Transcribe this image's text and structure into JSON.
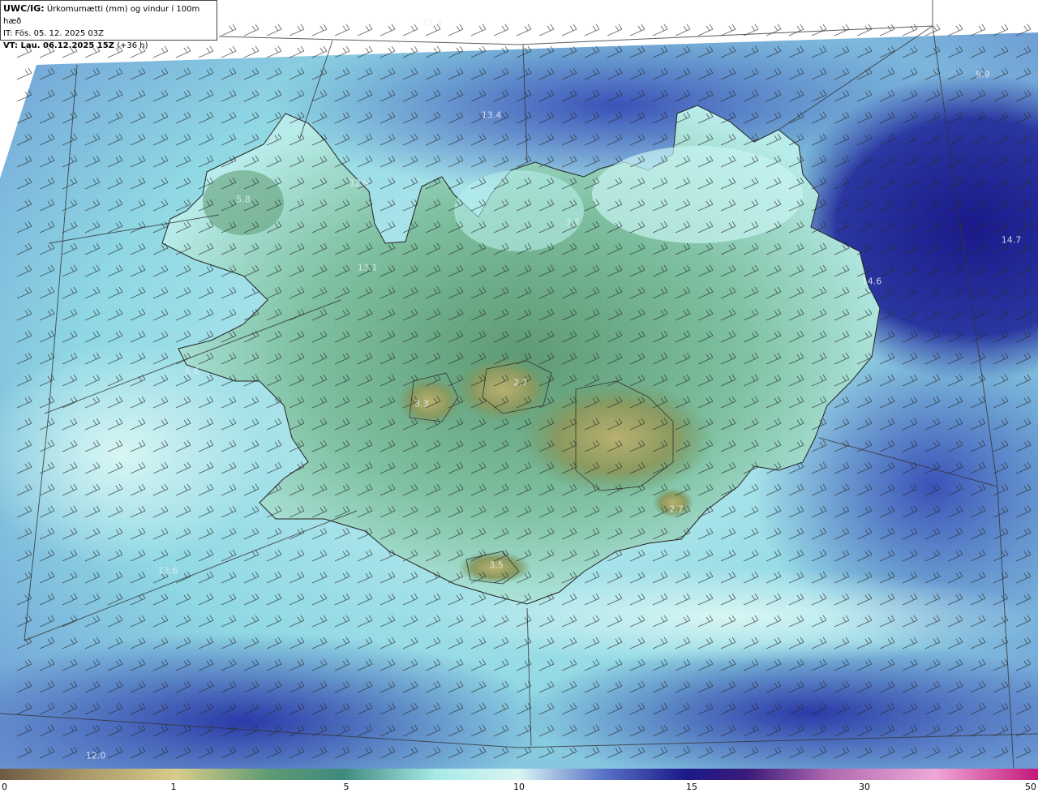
{
  "header": {
    "model": "UWC/IG:",
    "title": "Úrkomumætti (mm) og vindur í 100m hæð",
    "issue_time": "IT: Fös. 05. 12. 2025 03Z",
    "valid_prefix": "VT: Lau. 06.12.2025 15Z",
    "valid_offset": "(+36 h)"
  },
  "legend": {
    "ticks": [
      "0",
      "1",
      "5",
      "10",
      "15",
      "30",
      "50"
    ],
    "colors": [
      "#6e5a43",
      "#a9976a",
      "#d8cc8a",
      "#5e9a73",
      "#3e8a7e",
      "#a8eae6",
      "#d8f4f2",
      "#5a74c8",
      "#1a1a8a",
      "#3a1a7a",
      "#b06ab0",
      "#f0a8d8",
      "#c2187a"
    ]
  },
  "value_labels": [
    {
      "text": "12.4"
    },
    {
      "text": "13.4"
    },
    {
      "text": "9.9"
    },
    {
      "text": "12.9"
    },
    {
      "text": "5.8"
    },
    {
      "text": "13.1"
    },
    {
      "text": "3.7"
    },
    {
      "text": "14.7"
    },
    {
      "text": "14.6"
    },
    {
      "text": "5.6"
    },
    {
      "text": "3.3"
    },
    {
      "text": "2.7"
    },
    {
      "text": "12.6"
    },
    {
      "text": "3.5"
    },
    {
      "text": "2.7"
    },
    {
      "text": "12.0"
    }
  ]
}
